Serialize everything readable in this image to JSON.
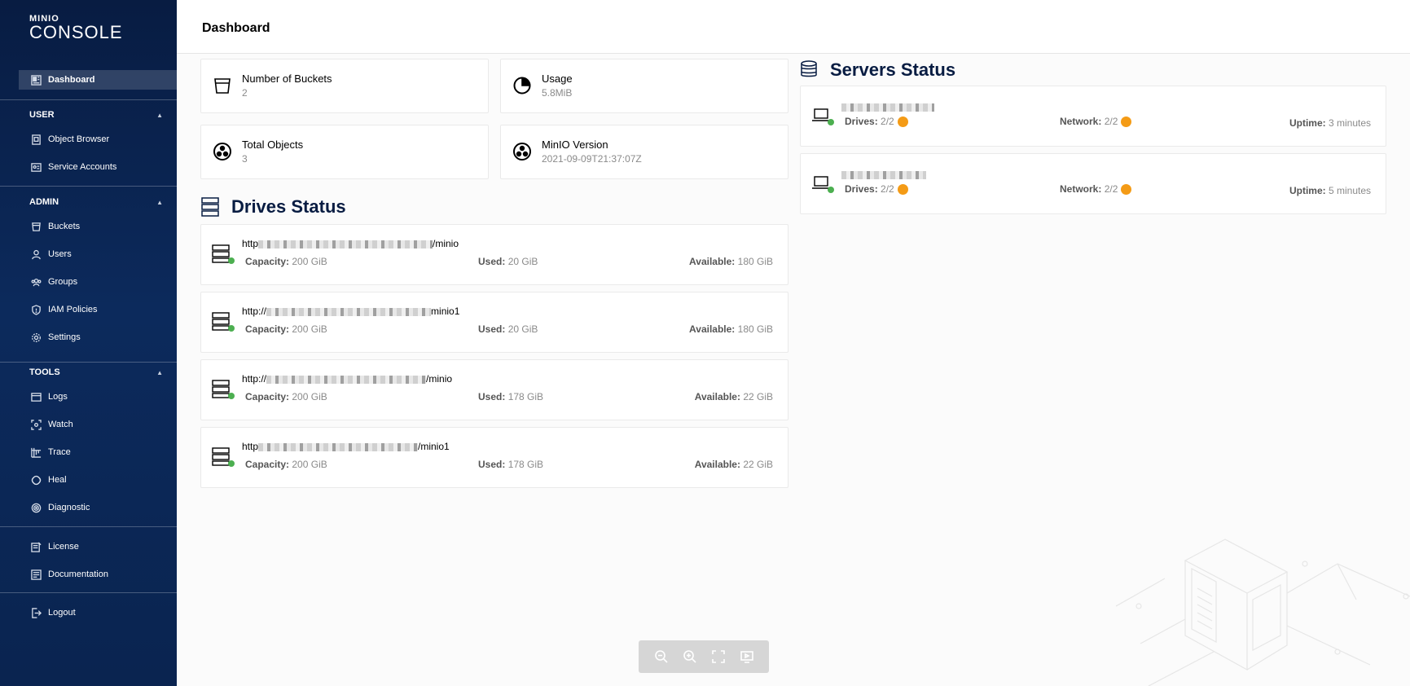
{
  "sidebar": {
    "logo_small": "MINIO",
    "logo_big": "CONSOLE",
    "dashboard": "Dashboard",
    "sections": {
      "user": "USER",
      "admin": "ADMIN",
      "tools": "TOOLS"
    },
    "user_items": [
      "Object Browser",
      "Service Accounts"
    ],
    "admin_items": [
      "Buckets",
      "Users",
      "Groups",
      "IAM Policies",
      "Settings"
    ],
    "tools_items": [
      "Logs",
      "Watch",
      "Trace",
      "Heal",
      "Diagnostic"
    ],
    "bottom_items": [
      "License",
      "Documentation"
    ],
    "logout": "Logout"
  },
  "header": {
    "title": "Dashboard"
  },
  "summary": {
    "buckets": {
      "label": "Number of Buckets",
      "value": "2"
    },
    "usage": {
      "label": "Usage",
      "value": "5.8MiB"
    },
    "objects": {
      "label": "Total Objects",
      "value": "3"
    },
    "version": {
      "label": "MinIO Version",
      "value": "2021-09-09T21:37:07Z"
    }
  },
  "drives": {
    "title": "Drives Status",
    "items": [
      {
        "url_prefix": "http",
        "url_suffix": "/minio",
        "capacity_label": "Capacity:",
        "capacity": "200 GiB",
        "used_label": "Used:",
        "used": "20 GiB",
        "available_label": "Available:",
        "available": "180 GiB"
      },
      {
        "url_prefix": "http://",
        "url_suffix": "minio1",
        "capacity_label": "Capacity:",
        "capacity": "200 GiB",
        "used_label": "Used:",
        "used": "20 GiB",
        "available_label": "Available:",
        "available": "180 GiB"
      },
      {
        "url_prefix": "http://",
        "url_suffix": "/minio",
        "capacity_label": "Capacity:",
        "capacity": "200 GiB",
        "used_label": "Used:",
        "used": "178 GiB",
        "available_label": "Available:",
        "available": "22 GiB"
      },
      {
        "url_prefix": "http",
        "url_suffix": "/minio1",
        "capacity_label": "Capacity:",
        "capacity": "200 GiB",
        "used_label": "Used:",
        "used": "178 GiB",
        "available_label": "Available:",
        "available": "22 GiB"
      }
    ]
  },
  "servers": {
    "title": "Servers Status",
    "items": [
      {
        "drives_label": "Drives:",
        "drives": "2/2",
        "network_label": "Network:",
        "network": "2/2",
        "uptime_label": "Uptime:",
        "uptime": "3 minutes"
      },
      {
        "drives_label": "Drives:",
        "drives": "2/2",
        "network_label": "Network:",
        "network": "2/2",
        "uptime_label": "Uptime:",
        "uptime": "5 minutes"
      }
    ]
  },
  "colors": {
    "sidebar": "#081c42",
    "online": "#4caf50",
    "warning": "#f49b16"
  }
}
